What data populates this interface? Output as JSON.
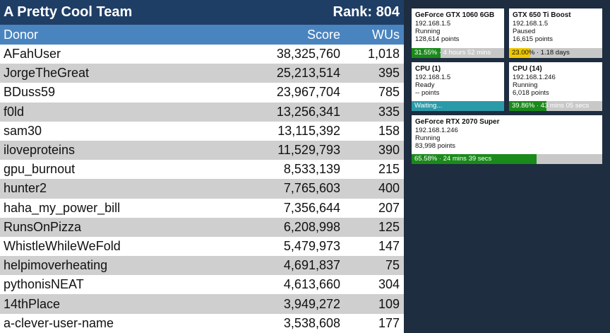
{
  "team": {
    "name": "A Pretty Cool Team",
    "rank_label": "Rank: 804",
    "columns": {
      "donor": "Donor",
      "score": "Score",
      "wus": "WUs"
    },
    "donors": [
      {
        "name": "AFahUser",
        "score": "38,325,760",
        "wus": "1,018"
      },
      {
        "name": "JorgeTheGreat",
        "score": "25,213,514",
        "wus": "395"
      },
      {
        "name": "BDuss59",
        "score": "23,967,704",
        "wus": "785"
      },
      {
        "name": "f0ld",
        "score": "13,256,341",
        "wus": "335"
      },
      {
        "name": "sam30",
        "score": "13,115,392",
        "wus": "158"
      },
      {
        "name": "iloveproteins",
        "score": "11,529,793",
        "wus": "390"
      },
      {
        "name": "gpu_burnout",
        "score": "8,533,139",
        "wus": "215"
      },
      {
        "name": "hunter2",
        "score": "7,765,603",
        "wus": "400"
      },
      {
        "name": "haha_my_power_bill",
        "score": "7,356,644",
        "wus": "207"
      },
      {
        "name": "RunsOnPizza",
        "score": "6,208,998",
        "wus": "125"
      },
      {
        "name": "WhistleWhileWeFold",
        "score": "5,479,973",
        "wus": "147"
      },
      {
        "name": "helpimoverheating",
        "score": "4,691,837",
        "wus": "75"
      },
      {
        "name": "pythonisNEAT",
        "score": "4,613,660",
        "wus": "304"
      },
      {
        "name": "14thPlace",
        "score": "3,949,272",
        "wus": "109"
      },
      {
        "name": "a-clever-user-name",
        "score": "3,538,608",
        "wus": "177"
      }
    ]
  },
  "clients": [
    {
      "name": "GeForce GTX 1060 6GB",
      "ip": "192.168.1.5",
      "status": "Running",
      "points": "128,614 points",
      "progress": 0.3155,
      "bar_text": "31.55% · 4 hours 52 mins",
      "bar_color": "#1a8a1a",
      "text_dark": false
    },
    {
      "name": "GTX 650 Ti Boost",
      "ip": "192.168.1.5",
      "status": "Paused",
      "points": "16,615 points",
      "progress": 0.23,
      "bar_text": "23.00% · 1.18 days",
      "bar_color": "#f0c800",
      "text_dark": true
    },
    {
      "name": "CPU (1)",
      "ip": "192.168.1.5",
      "status": "Ready",
      "points": "-- points",
      "progress": 1.0,
      "bar_text": "Waiting...",
      "bar_color": "#2a9aa8",
      "text_dark": false
    },
    {
      "name": "CPU (14)",
      "ip": "192.168.1.246",
      "status": "Running",
      "points": "6,018 points",
      "progress": 0.3986,
      "bar_text": "39.86% · 43 mins 05 secs",
      "bar_color": "#1a8a1a",
      "text_dark": false
    },
    {
      "name": "GeForce RTX 2070 Super",
      "ip": "192.168.1.246",
      "status": "Running",
      "points": "83,998 points",
      "progress": 0.6558,
      "bar_text": "65.58% · 24 mins 39 secs",
      "bar_color": "#1a8a1a",
      "text_dark": false
    }
  ]
}
